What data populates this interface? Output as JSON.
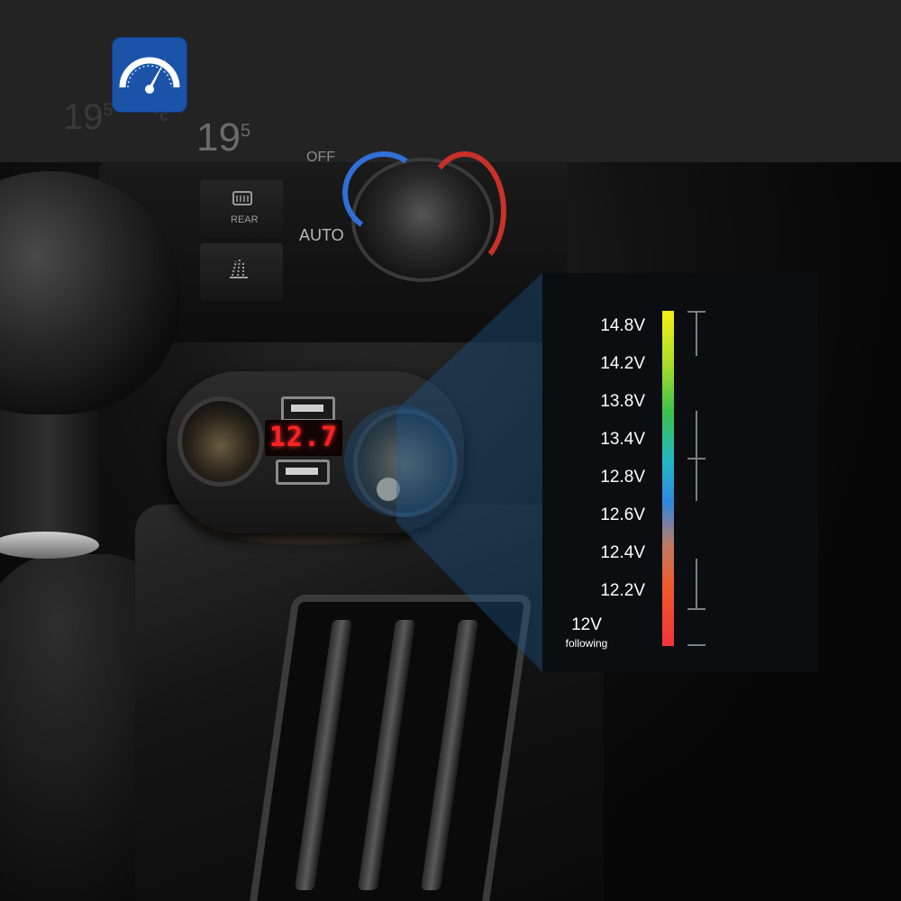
{
  "top_banner": {
    "logo_icon": "speedometer-gauge-icon",
    "logo_color": "#1b53a8",
    "hvac_left_temp": "19",
    "hvac_left_temp_decimal": "5",
    "hvac_left_unit": "°c",
    "hvac_main_temp": "19",
    "hvac_main_temp_decimal": "5",
    "off_label": "OFF"
  },
  "dashboard": {
    "rear_button_label": "REAR",
    "auto_button_label": "AUTO",
    "rear_icon": "rear-defrost-icon",
    "seat_icon": "windshield-airflow-icon"
  },
  "charger": {
    "voltage_display": "12.7",
    "display_color": "#ff2222"
  },
  "voltage_scale": {
    "levels": [
      "14.8V",
      "14.2V",
      "13.8V",
      "13.4V",
      "12.8V",
      "12.6V",
      "12.4V",
      "12.2V"
    ],
    "bottom_label": "12V",
    "bottom_sublabel": "following",
    "gradient_colors": [
      "#f6ef16",
      "#3cc24a",
      "#2f88e0",
      "#f05a2a",
      "#f2343a"
    ]
  }
}
